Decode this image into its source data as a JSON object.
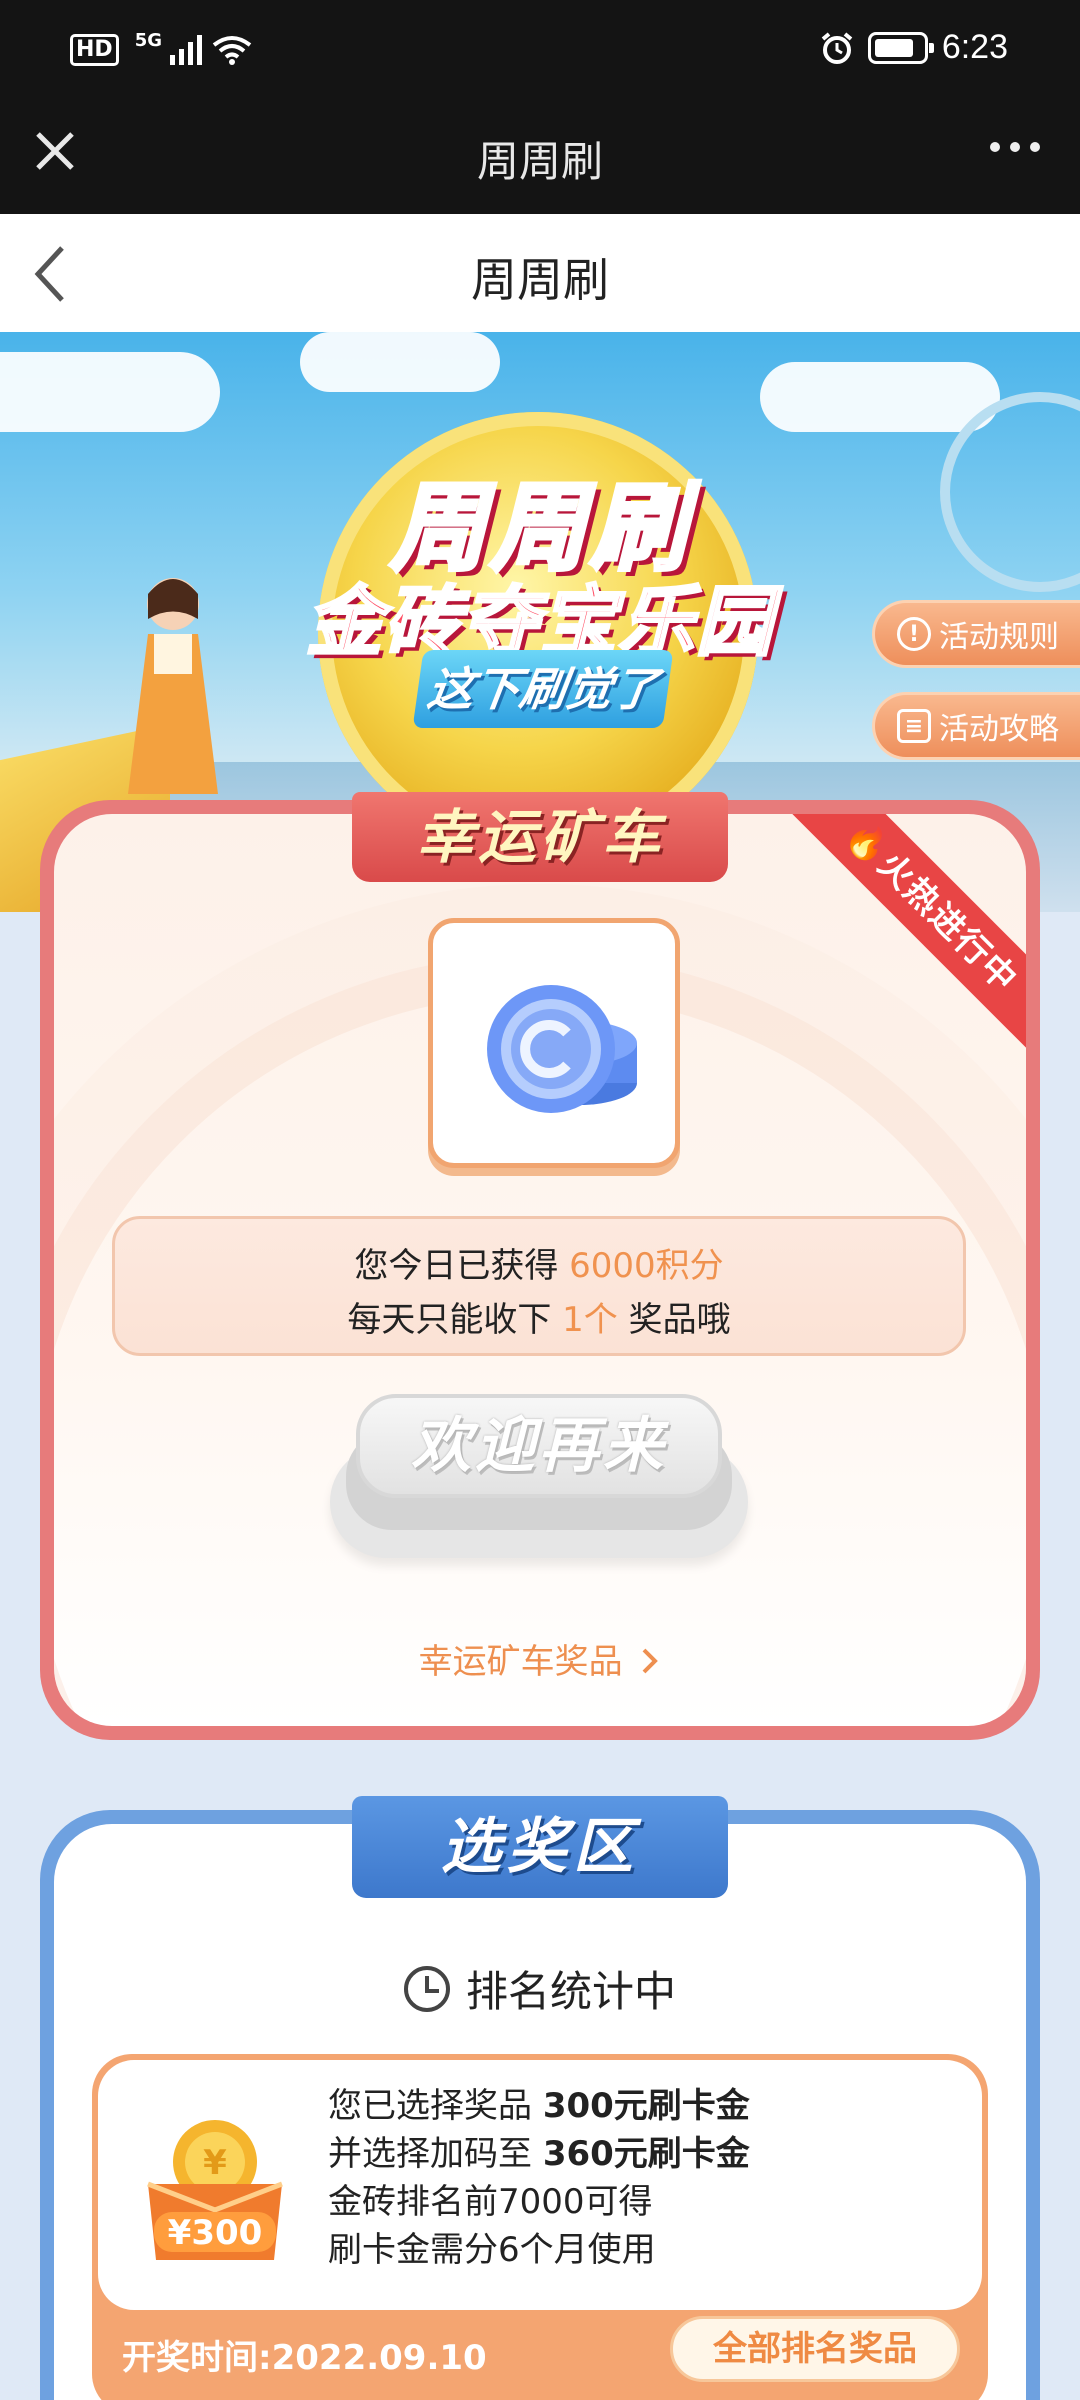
{
  "status_bar": {
    "left_indicators": [
      "HD",
      "5G"
    ],
    "time": "6:23",
    "battery_level": 0.8
  },
  "wechat_bar": {
    "title": "周周刷",
    "close_icon": "close-icon",
    "more_icon": "more-dots-icon"
  },
  "page_header": {
    "title": "周周刷",
    "back_icon": "chevron-left-icon"
  },
  "banner": {
    "title_line1": "周周刷",
    "title_line2": "金砖夺宝乐园",
    "slogan": "这下刷觉了",
    "rules_button": "活动规则",
    "guide_button": "活动攻略"
  },
  "lucky_cart": {
    "heading": "幸运矿车",
    "corner_badge": "火热进行中",
    "info_line1_prefix": "您今日已获得 ",
    "info_line1_highlight": "6000积分",
    "info_line2_prefix": "每天只能收下 ",
    "info_line2_highlight": "1个",
    "info_line2_suffix": " 奖品哦",
    "welcome_button": "欢迎再来",
    "prize_link": "幸运矿车奖品",
    "prize_link_icon": "chevron-right-icon"
  },
  "select_area": {
    "heading": "选奖区",
    "ranking_status": "排名统计中",
    "prize_card": {
      "line1_prefix": "您已选择奖品 ",
      "line1_value": "300元刷卡金",
      "line2_prefix": "并选择加码至 ",
      "line2_value": "360元刷卡金",
      "line3": "金砖排名前7000可得",
      "line4": "刷卡金需分6个月使用",
      "icon_amount": "¥300",
      "draw_time": "开奖时间:2022.09.10",
      "all_prizes_button": "全部排名奖品"
    }
  },
  "colors": {
    "accent_orange": "#ee8f4f",
    "lucky_border": "#e77b7b",
    "select_border": "#6ea1e0",
    "corner_red": "#e84545"
  }
}
